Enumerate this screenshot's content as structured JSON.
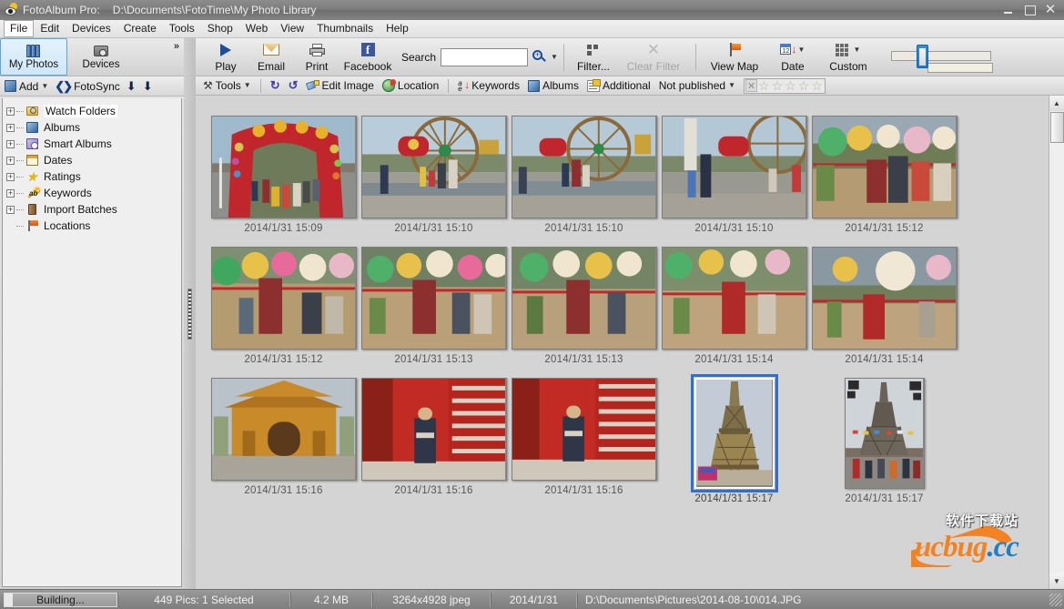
{
  "window": {
    "app_title": "FotoAlbum Pro:",
    "library_path": "D:\\Documents\\FotoTime\\My Photo Library",
    "icon": "photo-eye-icon",
    "minimize": "–",
    "maximize": "□",
    "close": "✕"
  },
  "menubar": {
    "items": [
      {
        "label": "File",
        "active": true
      },
      {
        "label": "Edit",
        "active": false
      },
      {
        "label": "Devices",
        "active": false
      },
      {
        "label": "Create",
        "active": false
      },
      {
        "label": "Tools",
        "active": false
      },
      {
        "label": "Shop",
        "active": false
      },
      {
        "label": "Web",
        "active": false
      },
      {
        "label": "View",
        "active": false
      },
      {
        "label": "Thumbnails",
        "active": false
      },
      {
        "label": "Help",
        "active": false
      }
    ]
  },
  "left_panel": {
    "tabs": [
      {
        "label": "My Photos",
        "icon": "books-icon",
        "selected": true
      },
      {
        "label": "Devices",
        "icon": "camera-icon",
        "selected": false
      }
    ],
    "overflow_chevron": "»",
    "actions": [
      {
        "label": "Add",
        "icon": "add-book-icon",
        "has_caret": true
      },
      {
        "label": "FotoSync",
        "icon": "sync-arrows-icon",
        "has_caret": false
      },
      {
        "label": "",
        "icon": "arrow-up-icon",
        "has_caret": false
      },
      {
        "label": "",
        "icon": "arrow-down-icon",
        "has_caret": false
      }
    ],
    "tree": [
      {
        "label": "Watch Folders",
        "icon": "folder-search-icon",
        "expandable": true,
        "selected": true
      },
      {
        "label": "Albums",
        "icon": "albums-icon",
        "expandable": true,
        "selected": false
      },
      {
        "label": "Smart Albums",
        "icon": "smart-albums-icon",
        "expandable": true,
        "selected": false
      },
      {
        "label": "Dates",
        "icon": "calendar-icon",
        "expandable": true,
        "selected": false
      },
      {
        "label": "Ratings",
        "icon": "star-icon",
        "expandable": true,
        "selected": false
      },
      {
        "label": "Keywords",
        "icon": "keyword-key-icon",
        "expandable": true,
        "selected": false
      },
      {
        "label": "Import Batches",
        "icon": "film-roll-icon",
        "expandable": true,
        "selected": false
      },
      {
        "label": "Locations",
        "icon": "flag-icon",
        "expandable": false,
        "selected": false
      }
    ],
    "expander_glyph": "+"
  },
  "toolbar_main": {
    "buttons": [
      {
        "label": "Play",
        "icon": "play-icon",
        "disabled": false
      },
      {
        "label": "Email",
        "icon": "envelope-icon",
        "disabled": false
      },
      {
        "label": "Print",
        "icon": "printer-icon",
        "disabled": false
      },
      {
        "label": "Facebook",
        "icon": "facebook-icon",
        "disabled": false
      }
    ],
    "search": {
      "label": "Search",
      "value": "",
      "placeholder": "",
      "icon": "magnifier-plus-icon",
      "caret": "▾"
    },
    "filter_buttons": [
      {
        "label": "Filter...",
        "icon": "filter-icon",
        "disabled": false
      },
      {
        "label": "Clear Filter",
        "icon": "clear-filter-x-icon",
        "disabled": true
      }
    ],
    "view_buttons": [
      {
        "label": "View Map",
        "icon": "map-flag-icon",
        "has_caret": false
      },
      {
        "label": "Date",
        "icon": "date-sort-icon",
        "has_caret": true
      },
      {
        "label": "Custom",
        "icon": "grid-dots-icon",
        "has_caret": true
      }
    ],
    "zoom_slider": {
      "name": "thumbnail-size-slider",
      "value": 26,
      "min": 0,
      "max": 100
    }
  },
  "toolbar_secondary": {
    "items": [
      {
        "label": "Tools",
        "icon": "tools-hammer-icon",
        "has_caret": true
      },
      {
        "label": "",
        "icon": "rotate-left-icon",
        "has_caret": false
      },
      {
        "label": "",
        "icon": "rotate-right-icon",
        "has_caret": false
      },
      {
        "label": "Edit Image",
        "icon": "edit-image-icon",
        "has_caret": false
      },
      {
        "label": "Location",
        "icon": "globe-pin-icon",
        "has_caret": false
      },
      {
        "label": "Keywords",
        "icon": "sort-az-icon",
        "has_caret": false
      },
      {
        "label": "Albums",
        "icon": "albums-icon",
        "has_caret": false
      },
      {
        "label": "Additional",
        "icon": "additional-properties-icon",
        "has_caret": false
      },
      {
        "label": "Not published",
        "icon": "",
        "has_caret": true
      }
    ],
    "rating": {
      "clear_glyph": "✕",
      "stars": 5,
      "filled": 0,
      "star_glyph": "☆"
    }
  },
  "photo_grid": {
    "rows": [
      [
        {
          "caption": "2014/1/31  15:09",
          "orientation": "landscape",
          "selected": false,
          "scene": "lantern-arch"
        },
        {
          "caption": "2014/1/31  15:10",
          "orientation": "landscape",
          "selected": false,
          "scene": "ferris-wheel"
        },
        {
          "caption": "2014/1/31  15:10",
          "orientation": "landscape",
          "selected": false,
          "scene": "ferris-wheel"
        },
        {
          "caption": "2014/1/31  15:10",
          "orientation": "landscape",
          "selected": false,
          "scene": "ferris-wheel"
        },
        {
          "caption": "2014/1/31  15:12",
          "orientation": "landscape",
          "selected": false,
          "scene": "lantern-garden"
        }
      ],
      [
        {
          "caption": "2014/1/31  15:12",
          "orientation": "landscape",
          "selected": false,
          "scene": "lantern-garden"
        },
        {
          "caption": "2014/1/31  15:13",
          "orientation": "landscape",
          "selected": false,
          "scene": "lantern-garden"
        },
        {
          "caption": "2014/1/31  15:13",
          "orientation": "landscape",
          "selected": false,
          "scene": "lantern-garden"
        },
        {
          "caption": "2014/1/31  15:14",
          "orientation": "landscape",
          "selected": false,
          "scene": "lantern-garden"
        },
        {
          "caption": "2014/1/31  15:14",
          "orientation": "landscape",
          "selected": false,
          "scene": "lantern-garden"
        }
      ],
      [
        {
          "caption": "2014/1/31  15:16",
          "orientation": "landscape",
          "selected": false,
          "scene": "pagoda-gate"
        },
        {
          "caption": "2014/1/31  15:16",
          "orientation": "landscape",
          "selected": false,
          "scene": "red-steps"
        },
        {
          "caption": "2014/1/31  15:16",
          "orientation": "landscape",
          "selected": false,
          "scene": "red-steps"
        },
        {
          "caption": "2014/1/31  15:17",
          "orientation": "portrait",
          "selected": true,
          "scene": "eiffel-tower"
        },
        {
          "caption": "2014/1/31  15:17",
          "orientation": "portrait",
          "selected": false,
          "scene": "eiffel-tower-crowd"
        }
      ]
    ]
  },
  "scrollbar": {
    "up_glyph": "▲",
    "down_glyph": "▼"
  },
  "statusbar": {
    "progress_text": "Building...",
    "progress_percent": 7,
    "count": "449 Pics: 1 Selected",
    "size": "4.2 MB",
    "dimensions": "3264x4928 jpeg",
    "date": "2014/1/31",
    "path": "D:\\Documents\\Pictures\\2014-08-10\\014.JPG"
  },
  "watermark": {
    "brand": "ucbug.cc",
    "brand_main": "ucbug",
    "brand_tld": ".cc",
    "chinese": "软件下载站"
  },
  "colors": {
    "accent": "#2f6fd0",
    "titlebar": "#7b7b7b",
    "watermark_orange": "#f58220",
    "watermark_blue": "#1f7ec4"
  }
}
